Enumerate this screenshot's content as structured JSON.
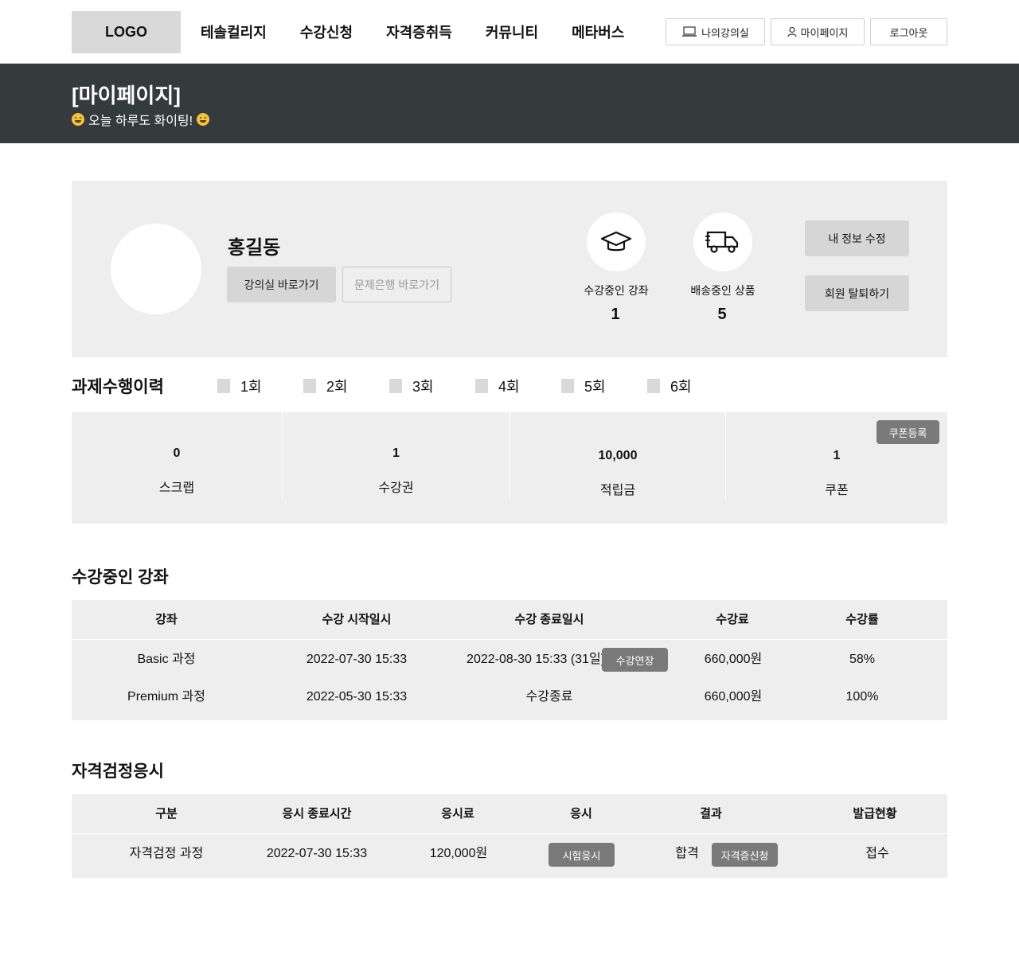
{
  "header": {
    "logo": "LOGO",
    "nav": [
      "테솔컬리지",
      "수강신청",
      "자격증취득",
      "커뮤니티",
      "메타버스"
    ],
    "utils": {
      "classroom": "나의강의실",
      "mypage": "마이페이지",
      "logout": "로그아웃"
    }
  },
  "banner": {
    "title": "[마이페이지]",
    "subtitle": "오늘 하루도 화이팅!"
  },
  "profile": {
    "name": "홍길동",
    "classroom_btn": "강의실 바로가기",
    "bank_btn": "문제은행 바로가기",
    "stats": [
      {
        "label": "수강중인 강좌",
        "value": "1",
        "icon": "graduation-cap-icon"
      },
      {
        "label": "배송중인 상품",
        "value": "5",
        "icon": "delivery-truck-icon"
      }
    ],
    "edit_btn": "내 정보 수정",
    "withdraw_btn": "회원 탈퇴하기"
  },
  "history": {
    "title": "과제수행이력",
    "items": [
      "1회",
      "2회",
      "3회",
      "4회",
      "5회",
      "6회"
    ]
  },
  "summary": {
    "scrap": {
      "value": "0",
      "label": "스크랩"
    },
    "voucher": {
      "value": "1",
      "label": "수강권"
    },
    "points": {
      "value": "10,000",
      "label": "적립금"
    },
    "coupon": {
      "value": "1",
      "label": "쿠폰"
    },
    "coupon_btn": "쿠폰등록"
  },
  "courses": {
    "title": "수강중인 강좌",
    "headers": [
      "강좌",
      "수강 시작일시",
      "수강 종료일시",
      "수강료",
      "수강률"
    ],
    "rows": [
      {
        "name": "Basic 과정",
        "start": "2022-07-30 15:33",
        "end": "2022-08-30 15:33 (31일)",
        "action": "수강연장",
        "fee": "660,000원",
        "rate": "58%"
      },
      {
        "name": "Premium 과정",
        "start": "2022-05-30 15:33",
        "end": "수강종료",
        "fee": "660,000원",
        "rate": "100%"
      }
    ]
  },
  "exams": {
    "title": "자격검정응시",
    "headers": [
      "구분",
      "응시 종료시간",
      "응시료",
      "응시",
      "결과",
      "발급현황"
    ],
    "rows": [
      {
        "name": "자격검정 과정",
        "end": "2022-07-30 15:33",
        "fee": "120,000원",
        "action": "시험응시",
        "result": "합격",
        "result_action": "자격증신청",
        "status": "접수"
      }
    ]
  }
}
